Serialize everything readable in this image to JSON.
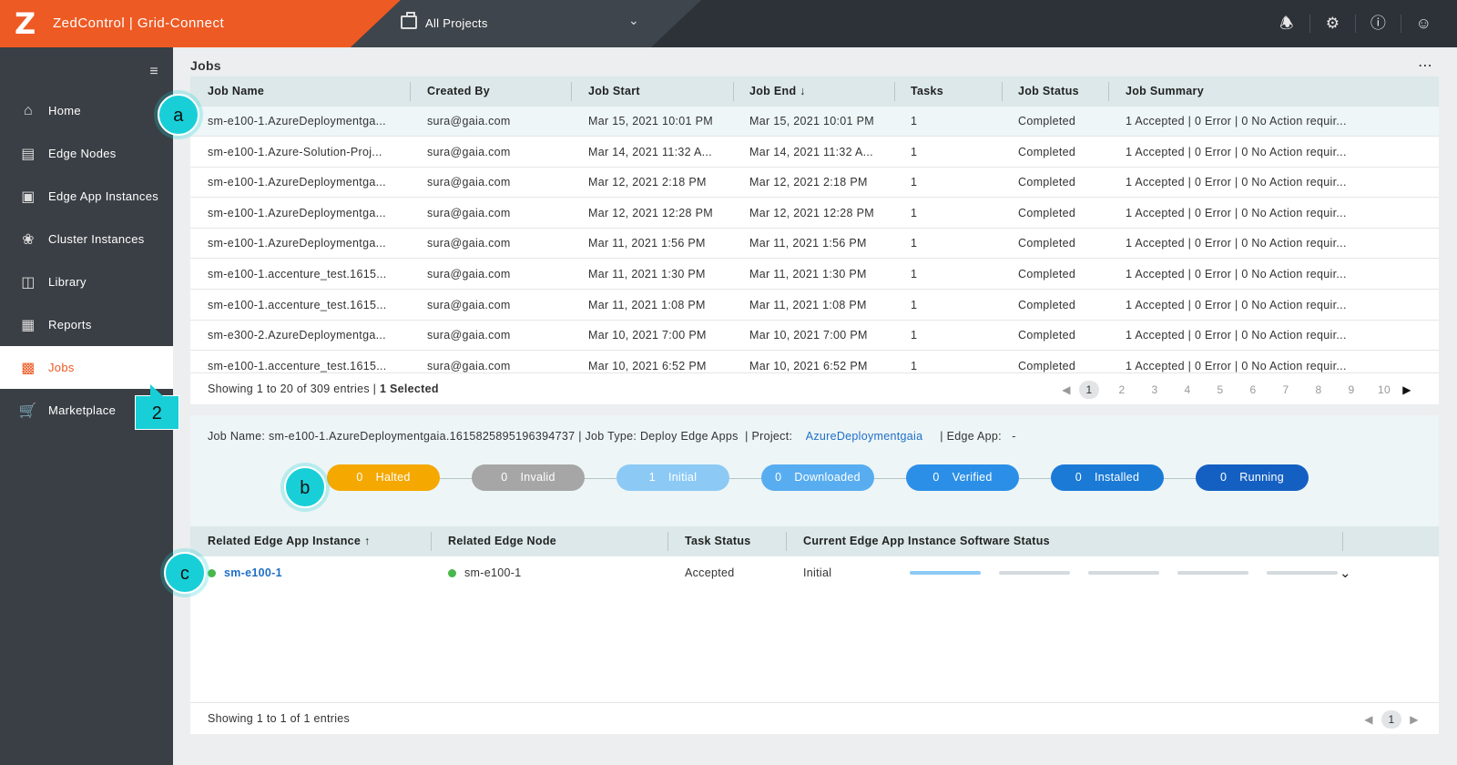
{
  "app": {
    "logo": "Z",
    "title": "ZedControl | Grid-Connect",
    "project_selector": "All Projects",
    "brand_color": "#ee5a24"
  },
  "top_icons": [
    "bell-icon",
    "gear-icon",
    "help-icon",
    "user-icon"
  ],
  "sidebar": {
    "items": [
      {
        "label": "Home",
        "icon": "home-icon"
      },
      {
        "label": "Edge Nodes",
        "icon": "edge-node-icon"
      },
      {
        "label": "Edge App Instances",
        "icon": "app-instance-icon"
      },
      {
        "label": "Cluster Instances",
        "icon": "cluster-icon"
      },
      {
        "label": "Library",
        "icon": "library-icon"
      },
      {
        "label": "Reports",
        "icon": "reports-icon"
      },
      {
        "label": "Jobs",
        "icon": "jobs-icon",
        "active": true
      },
      {
        "label": "Marketplace",
        "icon": "cart-icon"
      }
    ]
  },
  "main": {
    "title": "Jobs",
    "table": {
      "columns": [
        "Job Name",
        "Created By",
        "Job Start",
        "Job End ↓",
        "Tasks",
        "Job Status",
        "Job Summary"
      ],
      "rows": [
        [
          "sm-e100-1.AzureDeploymentga...",
          "sura@gaia.com",
          "Mar 15, 2021  10:01 PM",
          "Mar 15, 2021  10:01 PM",
          "1",
          "Completed",
          "1 Accepted | 0 Error | 0 No Action requir..."
        ],
        [
          "sm-e100-1.Azure-Solution-Proj...",
          "sura@gaia.com",
          "Mar 14, 2021  11:32 A...",
          "Mar 14, 2021  11:32 A...",
          "1",
          "Completed",
          "1 Accepted | 0 Error | 0 No Action requir..."
        ],
        [
          "sm-e100-1.AzureDeploymentga...",
          "sura@gaia.com",
          "Mar 12, 2021  2:18 PM",
          "Mar 12, 2021  2:18 PM",
          "1",
          "Completed",
          "1 Accepted | 0 Error | 0 No Action requir..."
        ],
        [
          "sm-e100-1.AzureDeploymentga...",
          "sura@gaia.com",
          "Mar 12, 2021  12:28 PM",
          "Mar 12, 2021  12:28 PM",
          "1",
          "Completed",
          "1 Accepted | 0 Error | 0 No Action requir..."
        ],
        [
          "sm-e100-1.AzureDeploymentga...",
          "sura@gaia.com",
          "Mar 11, 2021  1:56 PM",
          "Mar 11, 2021  1:56 PM",
          "1",
          "Completed",
          "1 Accepted | 0 Error | 0 No Action requir..."
        ],
        [
          "sm-e100-1.accenture_test.1615...",
          "sura@gaia.com",
          "Mar 11, 2021  1:30 PM",
          "Mar 11, 2021  1:30 PM",
          "1",
          "Completed",
          "1 Accepted | 0 Error | 0 No Action requir..."
        ],
        [
          "sm-e100-1.accenture_test.1615...",
          "sura@gaia.com",
          "Mar 11, 2021  1:08 PM",
          "Mar 11, 2021  1:08 PM",
          "1",
          "Completed",
          "1 Accepted | 0 Error | 0 No Action requir..."
        ],
        [
          "sm-e300-2.AzureDeploymentga...",
          "sura@gaia.com",
          "Mar 10, 2021  7:00 PM",
          "Mar 10, 2021  7:00 PM",
          "1",
          "Completed",
          "1 Accepted | 0 Error | 0 No Action requir..."
        ],
        [
          "sm-e100-1.accenture_test.1615...",
          "sura@gaia.com",
          "Mar 10, 2021  6:52 PM",
          "Mar 10, 2021  6:52 PM",
          "1",
          "Completed",
          "1 Accepted | 0 Error | 0 No Action requir..."
        ]
      ]
    },
    "footer": {
      "showing": "Showing 1 to 20 of 309 entries |",
      "selected": "1 Selected",
      "pages": [
        "1",
        "2",
        "3",
        "4",
        "5",
        "6",
        "7",
        "8",
        "9",
        "10"
      ],
      "current_page": "1"
    }
  },
  "detail": {
    "job_name_label": "Job Name:",
    "job_name": "sm-e100-1.AzureDeploymentgaia.1615825895196394737",
    "job_type_label": "| Job Type:",
    "job_type": "Deploy Edge Apps",
    "project_label": "|  Project:",
    "project": "AzureDeploymentgaia",
    "edge_app_label": "|  Edge App:",
    "edge_app": "-",
    "pipeline": [
      {
        "count": "0",
        "label": "Halted",
        "color": "#f5a800"
      },
      {
        "count": "0",
        "label": "Invalid",
        "color": "#a6a6a6"
      },
      {
        "count": "1",
        "label": "Initial",
        "color": "#8ccaf5"
      },
      {
        "count": "0",
        "label": "Downloaded",
        "color": "#58adf0"
      },
      {
        "count": "0",
        "label": "Verified",
        "color": "#2b8fe8"
      },
      {
        "count": "0",
        "label": "Installed",
        "color": "#1a7ad6"
      },
      {
        "count": "0",
        "label": "Running",
        "color": "#1460c2"
      }
    ],
    "table": {
      "columns": [
        "Related Edge App Instance ↑",
        "Related Edge Node",
        "Task Status",
        "Current Edge App Instance Software Status"
      ],
      "row": {
        "instance": "sm-e100-1",
        "node": "sm-e100-1",
        "task_status": "Accepted",
        "software_status": "Initial",
        "progress_steps": 5,
        "progress_done": 1
      }
    },
    "footer": {
      "showing": "Showing 1 to 1 of 1 entries",
      "current_page": "1"
    }
  },
  "callouts": {
    "a": "a",
    "b": "b",
    "c": "c",
    "n2": "2"
  }
}
